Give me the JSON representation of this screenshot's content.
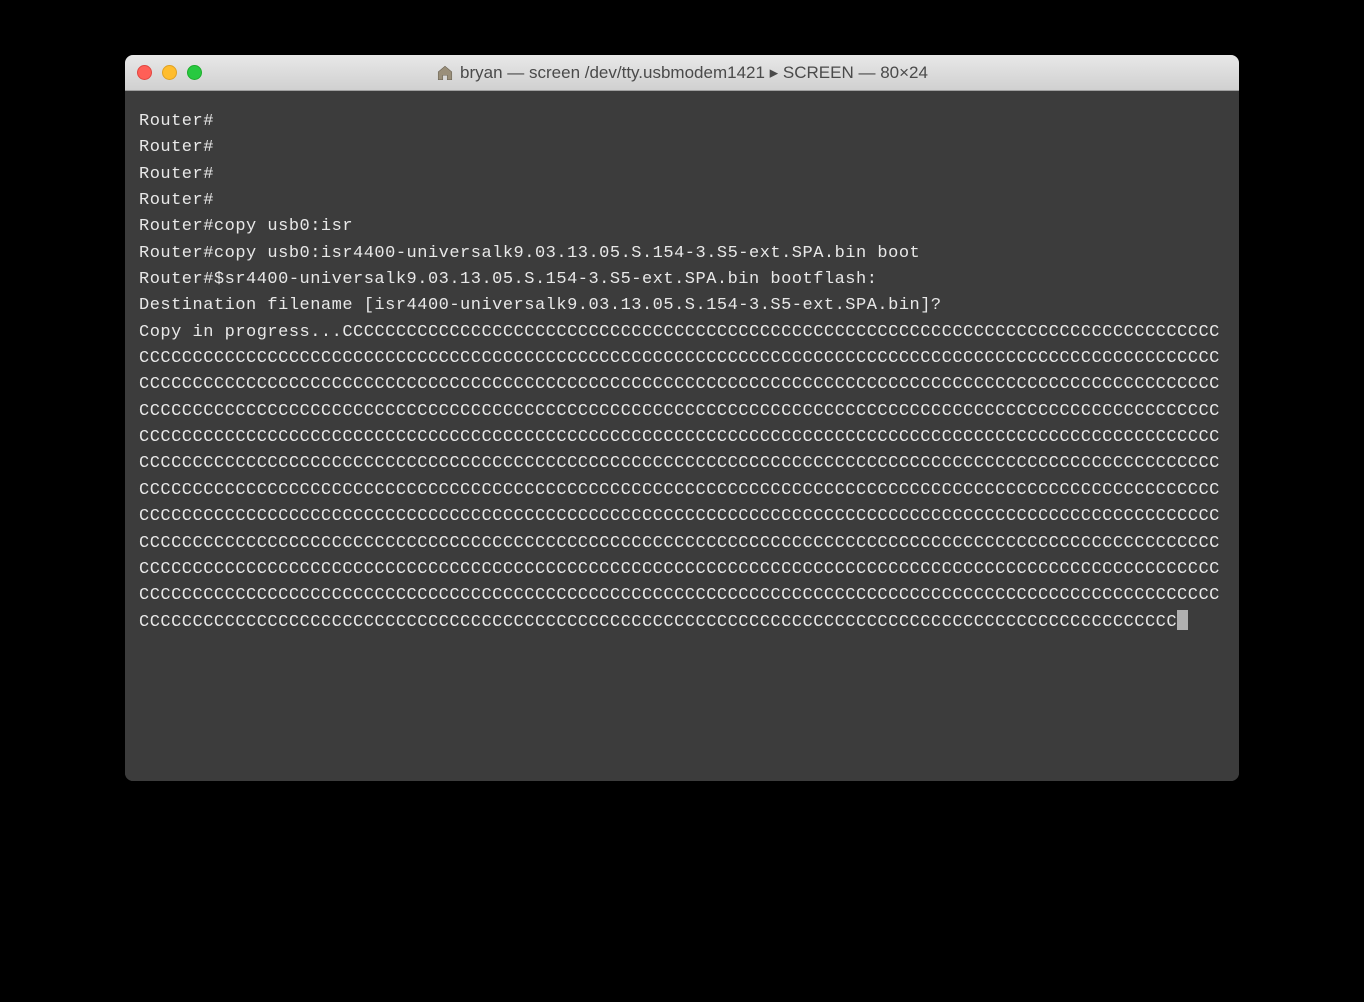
{
  "window": {
    "title": "bryan — screen /dev/tty.usbmodem1421 ▸ SCREEN — 80×24"
  },
  "terminal": {
    "lines": [
      "Router#",
      "Router#",
      "Router#",
      "Router#",
      "Router#copy usb0:isr",
      "Router#copy usb0:isr4400-universalk9.03.13.05.S.154-3.S5-ext.SPA.bin boot",
      "Router#$sr4400-universalk9.03.13.05.S.154-3.S5-ext.SPA.bin bootflash:",
      "Destination filename [isr4400-universalk9.03.13.05.S.154-3.S5-ext.SPA.bin]?",
      "Copy in progress...CCCCCCCCCCCCCCCCCCCCCCCCCCCCCCCCCCCCCCCCCCCCCCCCCCCCCCCCCCCCCCCCCCCCCCCCCCCCCCCCCCCCCCCCCCCCCCCCCCCCCCCCCCCCCCCCCCCCCCCCCCCCCCCCCCCCCCCCCCCCCCCCCCCCCCCCCCCCCCCCCCCCCCCCCCCCCCCCCCCCCCCCCCCCCCCCCCCCCCCCCCCCCCCCCCCCCCCCCCCCCCCCCCCCCCCCCCCCCCCCCCCCCCCCCCCCCCCCCCCCCCCCCCCCCCCCCCCCCCCCCCCCCCCCCCCCCCCCCCCCCCCCCCCCCCCCCCCCCCCCCCCCCCCCCCCCCCCCCCCCCCCCCCCCCCCCCCCCCCCCCCCCCCCCCCCCCCCCCCCCCCCCCCCCCCCCCCCCCCCCCCCCCCCCCCCCCCCCCCCCCCCCCCCCCCCCCCCCCCCCCCCCCCCCCCCCCCCCCCCCCCCCCCCCCCCCCCCCCCCCCCCCCCCCCCCCCCCCCCCCCCCCCCCCCCCCCCCCCCCCCCCCCCCCCCCCCCCCCCCCCCCCCCCCCCCCCCCCCCCCCCCCCCCCCCCCCCCCCCCCCCCCCCCCCCCCCCCCCCCCCCCCCCCCCCCCCCCCCCCCCCCCCCCCCCCCCCCCCCCCCCCCCCCCCCCCCCCCCCCCCCCCCCCCCCCCCCCCCCCCCCCCCCCCCCCCCCCCCCCCCCCCCCCCCCCCCCCCCCCCCCCCCCCCCCCCCCCCCCCCCCCCCCCCCCCCCCCCCCCCCCCCCCCCCCCCCCCCCCCCCCCCCCCCCCCCCCCCCCCCCCCCCCCCCCCCCCCCCCCCCCCCCCCCCCCCCCCCCCCCCCCCCCCCCCCCCCCCCCCCCCCCCCCCCCCCCCCCCCCCCCCCCCCCCCCCCCCCCCCCCCCCCCCCCCCCCCCCCCCCCCCCCCCCCCCCCCCCCCCCCCCCCCCCCCCCCCCCCCCCCCCCCCCCCCCCCCCCCCCCCCCCCCCCCCCCCCCCCCCCCCCCCCCCCCCCCCCCCCCCCCCCCCCCCCCCCCCCCCCCCCCCCCCCCCCCCCCCCCCCCCCCCCCCCCCCCCCCCCCCCCCCCCCCCCCCCCCCCCCCCCCCCCCCCCCCCCCCCCCCCCCCCCCCCCCCCCCCCCCCCCCCCCCCCCCCCCCCCCCCCCCCCCCCCCCCCCCCCCCCCCCCCCCCC"
    ]
  }
}
